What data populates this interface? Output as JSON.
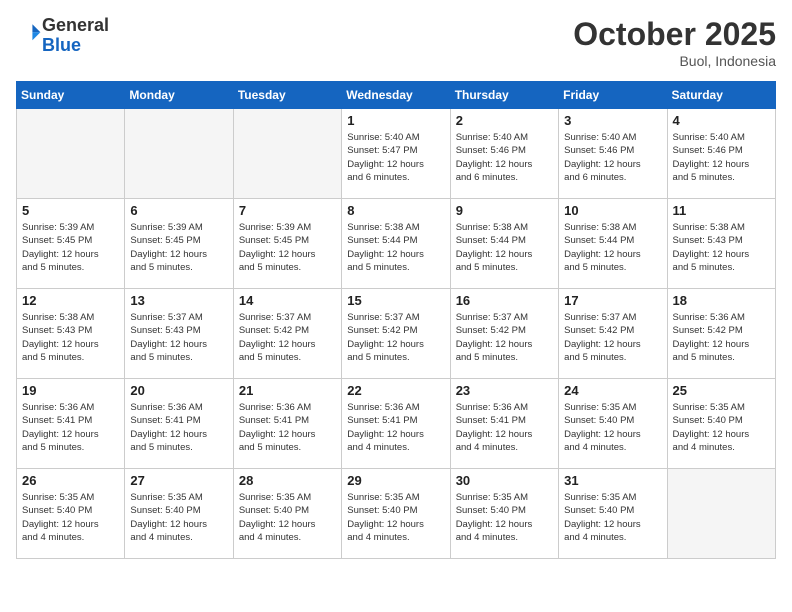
{
  "header": {
    "logo_general": "General",
    "logo_blue": "Blue",
    "month": "October 2025",
    "location": "Buol, Indonesia"
  },
  "days_of_week": [
    "Sunday",
    "Monday",
    "Tuesday",
    "Wednesday",
    "Thursday",
    "Friday",
    "Saturday"
  ],
  "weeks": [
    [
      {
        "day": "",
        "info": ""
      },
      {
        "day": "",
        "info": ""
      },
      {
        "day": "",
        "info": ""
      },
      {
        "day": "1",
        "info": "Sunrise: 5:40 AM\nSunset: 5:47 PM\nDaylight: 12 hours\nand 6 minutes."
      },
      {
        "day": "2",
        "info": "Sunrise: 5:40 AM\nSunset: 5:46 PM\nDaylight: 12 hours\nand 6 minutes."
      },
      {
        "day": "3",
        "info": "Sunrise: 5:40 AM\nSunset: 5:46 PM\nDaylight: 12 hours\nand 6 minutes."
      },
      {
        "day": "4",
        "info": "Sunrise: 5:40 AM\nSunset: 5:46 PM\nDaylight: 12 hours\nand 5 minutes."
      }
    ],
    [
      {
        "day": "5",
        "info": "Sunrise: 5:39 AM\nSunset: 5:45 PM\nDaylight: 12 hours\nand 5 minutes."
      },
      {
        "day": "6",
        "info": "Sunrise: 5:39 AM\nSunset: 5:45 PM\nDaylight: 12 hours\nand 5 minutes."
      },
      {
        "day": "7",
        "info": "Sunrise: 5:39 AM\nSunset: 5:45 PM\nDaylight: 12 hours\nand 5 minutes."
      },
      {
        "day": "8",
        "info": "Sunrise: 5:38 AM\nSunset: 5:44 PM\nDaylight: 12 hours\nand 5 minutes."
      },
      {
        "day": "9",
        "info": "Sunrise: 5:38 AM\nSunset: 5:44 PM\nDaylight: 12 hours\nand 5 minutes."
      },
      {
        "day": "10",
        "info": "Sunrise: 5:38 AM\nSunset: 5:44 PM\nDaylight: 12 hours\nand 5 minutes."
      },
      {
        "day": "11",
        "info": "Sunrise: 5:38 AM\nSunset: 5:43 PM\nDaylight: 12 hours\nand 5 minutes."
      }
    ],
    [
      {
        "day": "12",
        "info": "Sunrise: 5:38 AM\nSunset: 5:43 PM\nDaylight: 12 hours\nand 5 minutes."
      },
      {
        "day": "13",
        "info": "Sunrise: 5:37 AM\nSunset: 5:43 PM\nDaylight: 12 hours\nand 5 minutes."
      },
      {
        "day": "14",
        "info": "Sunrise: 5:37 AM\nSunset: 5:42 PM\nDaylight: 12 hours\nand 5 minutes."
      },
      {
        "day": "15",
        "info": "Sunrise: 5:37 AM\nSunset: 5:42 PM\nDaylight: 12 hours\nand 5 minutes."
      },
      {
        "day": "16",
        "info": "Sunrise: 5:37 AM\nSunset: 5:42 PM\nDaylight: 12 hours\nand 5 minutes."
      },
      {
        "day": "17",
        "info": "Sunrise: 5:37 AM\nSunset: 5:42 PM\nDaylight: 12 hours\nand 5 minutes."
      },
      {
        "day": "18",
        "info": "Sunrise: 5:36 AM\nSunset: 5:42 PM\nDaylight: 12 hours\nand 5 minutes."
      }
    ],
    [
      {
        "day": "19",
        "info": "Sunrise: 5:36 AM\nSunset: 5:41 PM\nDaylight: 12 hours\nand 5 minutes."
      },
      {
        "day": "20",
        "info": "Sunrise: 5:36 AM\nSunset: 5:41 PM\nDaylight: 12 hours\nand 5 minutes."
      },
      {
        "day": "21",
        "info": "Sunrise: 5:36 AM\nSunset: 5:41 PM\nDaylight: 12 hours\nand 5 minutes."
      },
      {
        "day": "22",
        "info": "Sunrise: 5:36 AM\nSunset: 5:41 PM\nDaylight: 12 hours\nand 4 minutes."
      },
      {
        "day": "23",
        "info": "Sunrise: 5:36 AM\nSunset: 5:41 PM\nDaylight: 12 hours\nand 4 minutes."
      },
      {
        "day": "24",
        "info": "Sunrise: 5:35 AM\nSunset: 5:40 PM\nDaylight: 12 hours\nand 4 minutes."
      },
      {
        "day": "25",
        "info": "Sunrise: 5:35 AM\nSunset: 5:40 PM\nDaylight: 12 hours\nand 4 minutes."
      }
    ],
    [
      {
        "day": "26",
        "info": "Sunrise: 5:35 AM\nSunset: 5:40 PM\nDaylight: 12 hours\nand 4 minutes."
      },
      {
        "day": "27",
        "info": "Sunrise: 5:35 AM\nSunset: 5:40 PM\nDaylight: 12 hours\nand 4 minutes."
      },
      {
        "day": "28",
        "info": "Sunrise: 5:35 AM\nSunset: 5:40 PM\nDaylight: 12 hours\nand 4 minutes."
      },
      {
        "day": "29",
        "info": "Sunrise: 5:35 AM\nSunset: 5:40 PM\nDaylight: 12 hours\nand 4 minutes."
      },
      {
        "day": "30",
        "info": "Sunrise: 5:35 AM\nSunset: 5:40 PM\nDaylight: 12 hours\nand 4 minutes."
      },
      {
        "day": "31",
        "info": "Sunrise: 5:35 AM\nSunset: 5:40 PM\nDaylight: 12 hours\nand 4 minutes."
      },
      {
        "day": "",
        "info": ""
      }
    ]
  ]
}
